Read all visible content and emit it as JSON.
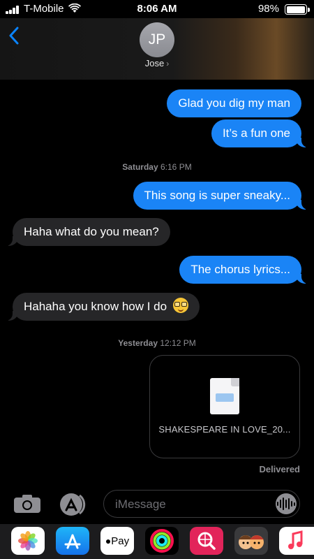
{
  "status_bar": {
    "carrier": "T-Mobile",
    "time": "8:06 AM",
    "battery": "98%",
    "icons": [
      "signal-icon",
      "wifi-icon",
      "battery-icon"
    ]
  },
  "header": {
    "back_icon": "chevron-left-icon",
    "avatar_initials": "JP",
    "contact_name": "Jose",
    "contact_chevron": "›"
  },
  "messages": [
    {
      "type": "sent",
      "text": "Glad you dig my man"
    },
    {
      "type": "sent",
      "text": "It’s a fun one"
    },
    {
      "type": "timestamp",
      "day": "Saturday",
      "time": "6:16 PM"
    },
    {
      "type": "sent",
      "text": "This song is super sneaky..."
    },
    {
      "type": "received",
      "text": "Haha what do you mean?"
    },
    {
      "type": "sent",
      "text": "The chorus lyrics..."
    },
    {
      "type": "received",
      "text": "Hahaha you know how I do",
      "emoji": "nerd-face"
    },
    {
      "type": "timestamp",
      "day": "Yesterday",
      "time": "12:12 PM"
    },
    {
      "type": "attachment",
      "file_name": "SHAKESPEARE IN LOVE_20...",
      "icon": "audio-file-icon"
    }
  ],
  "delivery_status": "Delivered",
  "input": {
    "placeholder": "iMessage",
    "value": ""
  },
  "app_drawer": [
    {
      "name": "photos-app",
      "label": ""
    },
    {
      "name": "app-store-app",
      "label": ""
    },
    {
      "name": "apple-pay-app",
      "label": "Pay"
    },
    {
      "name": "activity-app",
      "label": ""
    },
    {
      "name": "web-images-app",
      "label": ""
    },
    {
      "name": "memoji-app",
      "label": ""
    },
    {
      "name": "music-app",
      "label": ""
    }
  ],
  "colors": {
    "sent_bubble": "#1a84f6",
    "received_bubble": "#262628",
    "accent": "#0a84ff"
  }
}
